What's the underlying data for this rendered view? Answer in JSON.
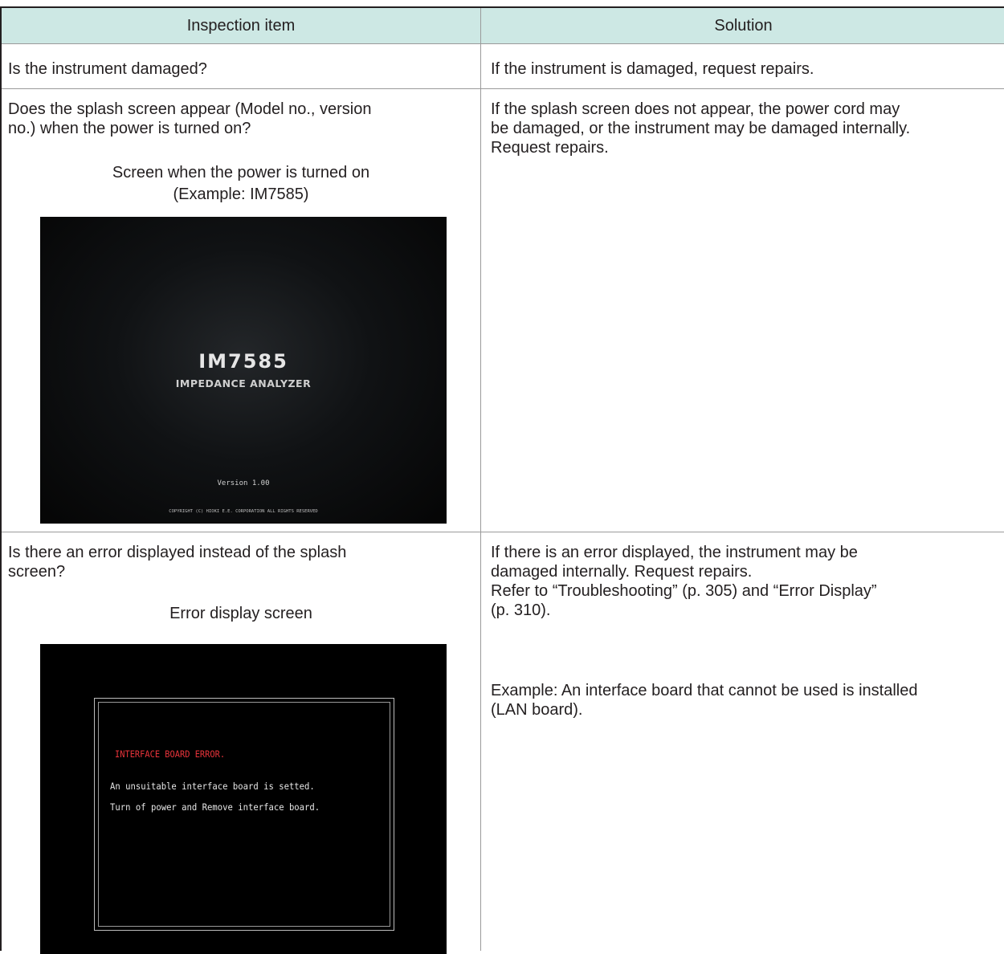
{
  "table": {
    "headers": [
      "Inspection item",
      "Solution"
    ],
    "rows": [
      {
        "item": "Is the instrument damaged?",
        "solution": "If the instrument is damaged, request repairs."
      },
      {
        "item_line1": "Does the splash screen appear (Model no., version",
        "item_line2": "no.) when the power is turned on?",
        "caption_line1": "Screen when the power is turned on",
        "caption_line2": "(Example: IM7585)",
        "screen": {
          "model": "IM7585",
          "subtitle": "IMPEDANCE ANALYZER",
          "version": "Version 1.00",
          "copyright": "COPYRIGHT (C) HIOKI E.E. CORPORATION ALL RIGHTS RESERVED"
        },
        "solution_line1": "If the splash screen does not appear, the power cord may",
        "solution_line2": "be damaged, or the instrument may be damaged internally.",
        "solution_line3": "Request repairs."
      },
      {
        "item_line1": "Is there an error displayed instead of the splash",
        "item_line2": "screen?",
        "caption": "Error display screen",
        "screen": {
          "error_title": "INTERFACE BOARD ERROR.",
          "error_line1": "An unsuitable interface board is setted.",
          "error_line2": "Turn of power and Remove interface board."
        },
        "solution_line1": "If there is an error displayed, the instrument may be",
        "solution_line2": "damaged internally. Request repairs.",
        "solution_line3": "Refer to “Troubleshooting” (p. 305) and “Error Display”",
        "solution_line4": "(p. 310).",
        "example_line1": "Example: An interface board that cannot be used is installed",
        "example_line2": "(LAN board)."
      }
    ]
  },
  "colors": {
    "header_bg": "#cde8e4",
    "border": "#9a9a9a",
    "error_text": "#e8333a"
  }
}
